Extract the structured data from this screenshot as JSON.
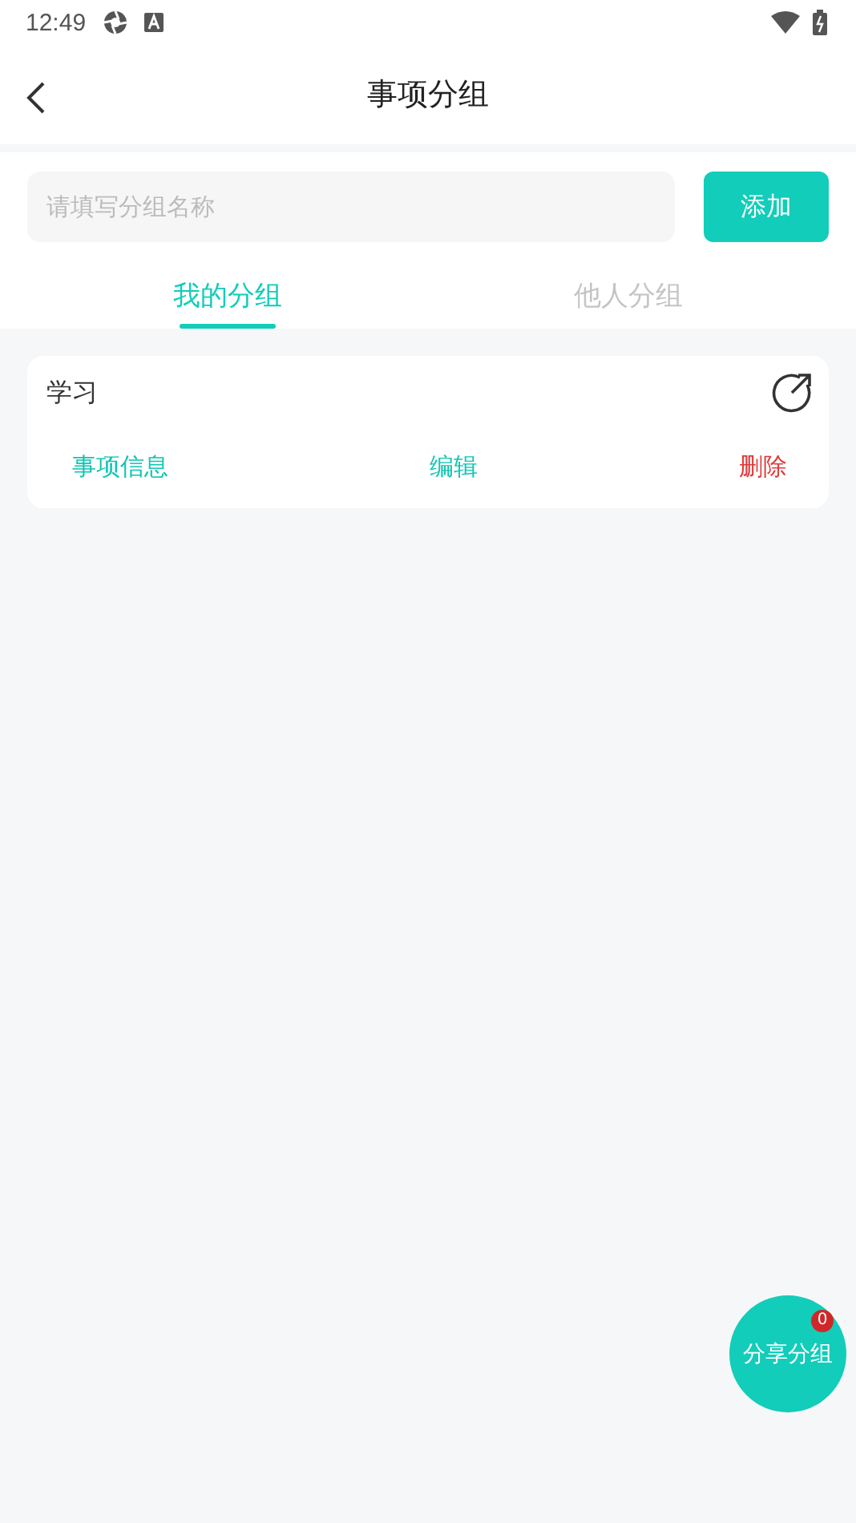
{
  "status_bar": {
    "time": "12:49"
  },
  "header": {
    "title": "事项分组"
  },
  "search": {
    "placeholder": "请填写分组名称",
    "button": "添加"
  },
  "tabs": [
    {
      "label": "我的分组",
      "selected": true
    },
    {
      "label": "他人分组",
      "selected": false
    }
  ],
  "groups": [
    {
      "name": "学习",
      "actions": [
        {
          "label": "事项信息",
          "kind": "info"
        },
        {
          "label": "编辑",
          "kind": "edit"
        },
        {
          "label": "删除",
          "kind": "delete"
        }
      ]
    }
  ],
  "share_button": {
    "label": "分享分组",
    "badge": "0"
  }
}
